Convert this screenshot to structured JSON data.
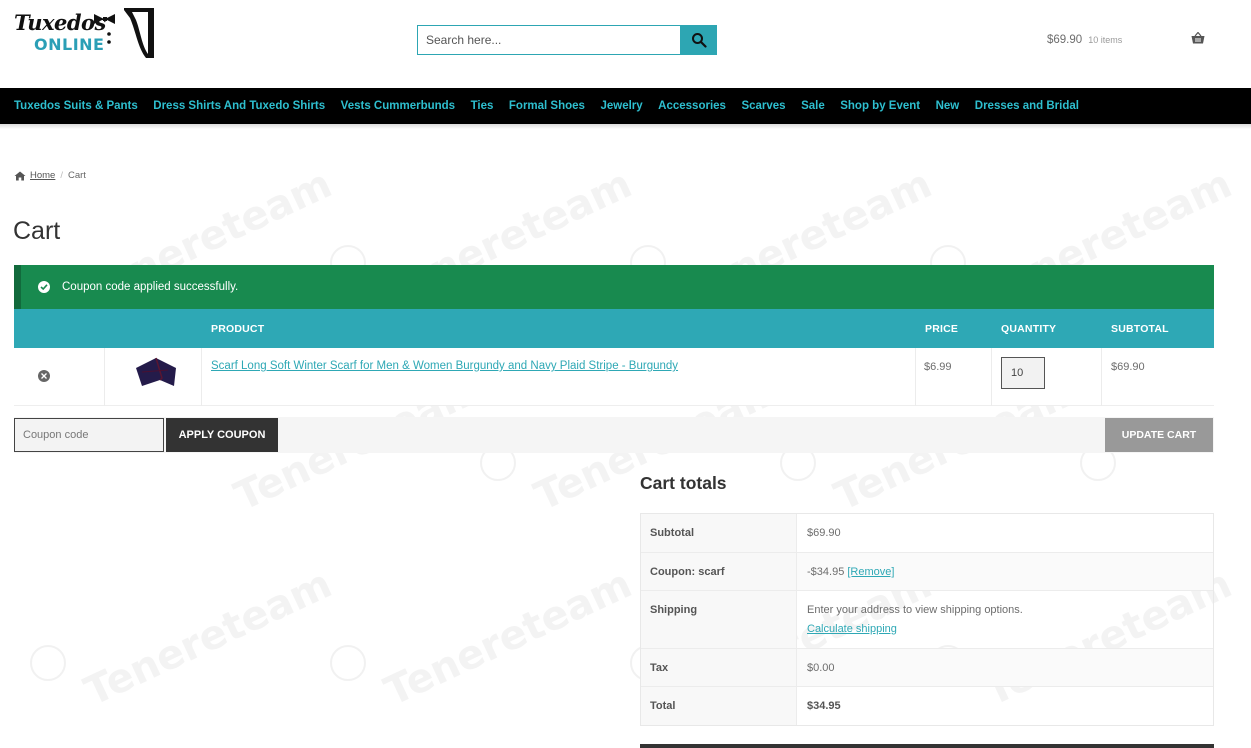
{
  "header": {
    "logo": {
      "line1": "Tuxedos",
      "line2": "ONLINE"
    },
    "search": {
      "placeholder": "Search here..."
    },
    "mini_cart": {
      "amount": "$69.90",
      "count": "10 items"
    }
  },
  "nav": {
    "items": [
      "Tuxedos Suits & Pants",
      "Dress Shirts And Tuxedo Shirts",
      "Vests Cummerbunds",
      "Ties",
      "Formal Shoes",
      "Jewelry",
      "Accessories",
      "Scarves",
      "Sale",
      "Shop by Event",
      "New",
      "Dresses and Bridal"
    ],
    "color": "#2ebfcf"
  },
  "breadcrumb": {
    "home": "Home",
    "current": "Cart"
  },
  "page": {
    "title": "Cart"
  },
  "notice": {
    "message": "Coupon code applied successfully.",
    "color": "#188a4f"
  },
  "cart": {
    "headers": {
      "product": "PRODUCT",
      "price": "PRICE",
      "quantity": "QUANTITY",
      "subtotal": "SUBTOTAL"
    },
    "items": [
      {
        "name": "Scarf Long Soft Winter Scarf for Men & Women Burgundy and Navy Plaid Stripe - Burgundy",
        "price": "$6.99",
        "quantity": "10",
        "subtotal": "$69.90"
      }
    ],
    "coupon_placeholder": "Coupon code",
    "apply_label": "APPLY COUPON",
    "update_label": "UPDATE CART",
    "accent": "#2ea8b5"
  },
  "totals": {
    "title": "Cart totals",
    "subtotal_label": "Subtotal",
    "subtotal_value": "$69.90",
    "coupon_label": "Coupon: scarf",
    "coupon_value": "-$34.95",
    "coupon_remove": "[Remove]",
    "shipping_label": "Shipping",
    "shipping_text": "Enter your address to view shipping options.",
    "shipping_link": "Calculate shipping",
    "tax_label": "Tax",
    "tax_value": "$0.00",
    "total_label": "Total",
    "total_value": "$34.95"
  },
  "watermark": {
    "text": "Tenereteam"
  }
}
